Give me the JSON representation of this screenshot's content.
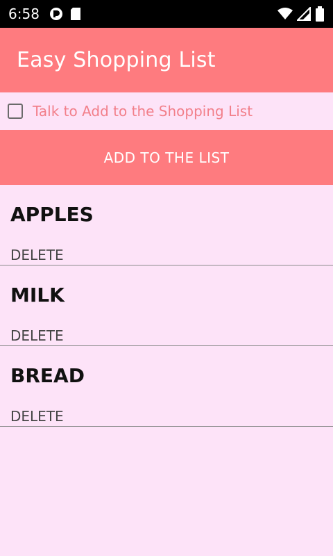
{
  "status_bar": {
    "time": "6:58",
    "icons": [
      "app-notification-icon",
      "sd-card-icon",
      "wifi-icon",
      "signal-icon",
      "battery-icon"
    ]
  },
  "app_bar": {
    "title": "Easy Shopping List"
  },
  "talk_option": {
    "label": "Talk to Add to the Shopping List",
    "checked": false
  },
  "add_button": {
    "label": "ADD TO THE LIST"
  },
  "items": [
    {
      "name": "APPLES",
      "delete_label": "DELETE"
    },
    {
      "name": "MILK",
      "delete_label": "DELETE"
    },
    {
      "name": "BREAD",
      "delete_label": "DELETE"
    }
  ],
  "colors": {
    "accent": "#fe7b7f",
    "background": "#fde3f8",
    "status_bar": "#000000",
    "talk_label": "#f27f8a"
  }
}
